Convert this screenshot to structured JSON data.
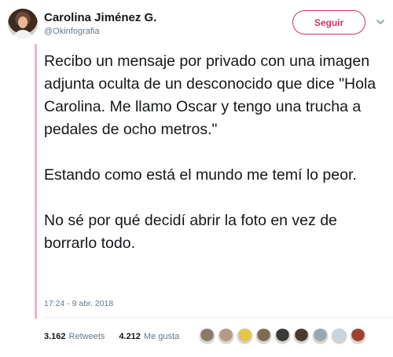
{
  "author": {
    "name": "Carolina Jiménez G.",
    "handle": "@Okinfografia"
  },
  "follow_button": {
    "label": "Seguir",
    "color": "#c9366f"
  },
  "menu_icon": "chevron-down-icon",
  "tweet": {
    "paragraphs": [
      "Recibo un mensaje por privado con una imagen adjunta oculta de un desconocido que dice \"Hola Carolina. Me llamo Oscar y tengo una trucha a pedales de ocho metros.\"",
      "Estando como está el mundo me temí lo peor.",
      "No sé por qué decidí abrir la foto en vez de borrarlo todo."
    ],
    "timestamp": "17:24 - 9 abr. 2018"
  },
  "stats": {
    "retweets_count": "3.162",
    "retweets_label": "Retweets",
    "likes_count": "4.212",
    "likes_label": "Me gusta"
  },
  "likers_avatars": [
    {
      "color": "#8a7a68"
    },
    {
      "color": "#b59a86"
    },
    {
      "color": "#e3c64a"
    },
    {
      "color": "#7f6a55"
    },
    {
      "color": "#3a3a3a"
    },
    {
      "color": "#4a3b30"
    },
    {
      "color": "#9aa6ad"
    },
    {
      "color": "#c9d4dc"
    },
    {
      "color": "#a0412f"
    }
  ]
}
